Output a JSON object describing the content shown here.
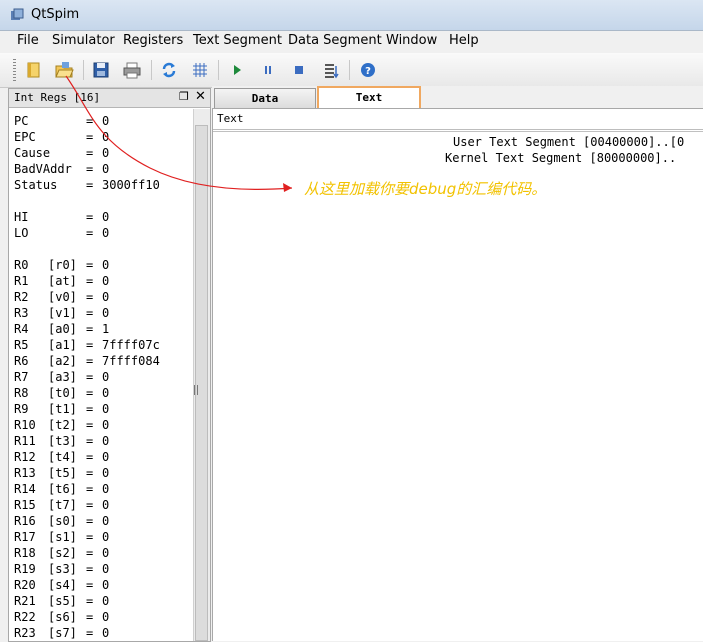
{
  "window": {
    "title": "QtSpim"
  },
  "menu": [
    "File",
    "Simulator",
    "Registers",
    "Text Segment",
    "Data Segment",
    "Window",
    "Help"
  ],
  "toolbar": {
    "icons": [
      "load-file-icon",
      "reload-file-icon",
      "save-log-icon",
      "print-icon",
      "clear-registers-icon",
      "run-grid-icon",
      "run-icon",
      "pause-icon",
      "stop-icon",
      "single-step-icon",
      "help-icon"
    ]
  },
  "registers_panel": {
    "title": "Int Regs [16]",
    "special": [
      {
        "name": "PC",
        "alias": "",
        "value": "0"
      },
      {
        "name": "EPC",
        "alias": "",
        "value": "0"
      },
      {
        "name": "Cause",
        "alias": "",
        "value": "0"
      },
      {
        "name": "BadVAddr",
        "alias": "",
        "value": "0"
      },
      {
        "name": "Status",
        "alias": "",
        "value": "3000ff10"
      },
      {
        "name": "HI",
        "alias": "",
        "value": "0"
      },
      {
        "name": "LO",
        "alias": "",
        "value": "0"
      }
    ],
    "general": [
      {
        "name": "R0",
        "alias": "[r0]",
        "value": "0"
      },
      {
        "name": "R1",
        "alias": "[at]",
        "value": "0"
      },
      {
        "name": "R2",
        "alias": "[v0]",
        "value": "0"
      },
      {
        "name": "R3",
        "alias": "[v1]",
        "value": "0"
      },
      {
        "name": "R4",
        "alias": "[a0]",
        "value": "1"
      },
      {
        "name": "R5",
        "alias": "[a1]",
        "value": "7ffff07c"
      },
      {
        "name": "R6",
        "alias": "[a2]",
        "value": "7ffff084"
      },
      {
        "name": "R7",
        "alias": "[a3]",
        "value": "0"
      },
      {
        "name": "R8",
        "alias": "[t0]",
        "value": "0"
      },
      {
        "name": "R9",
        "alias": "[t1]",
        "value": "0"
      },
      {
        "name": "R10",
        "alias": "[t2]",
        "value": "0"
      },
      {
        "name": "R11",
        "alias": "[t3]",
        "value": "0"
      },
      {
        "name": "R12",
        "alias": "[t4]",
        "value": "0"
      },
      {
        "name": "R13",
        "alias": "[t5]",
        "value": "0"
      },
      {
        "name": "R14",
        "alias": "[t6]",
        "value": "0"
      },
      {
        "name": "R15",
        "alias": "[t7]",
        "value": "0"
      },
      {
        "name": "R16",
        "alias": "[s0]",
        "value": "0"
      },
      {
        "name": "R17",
        "alias": "[s1]",
        "value": "0"
      },
      {
        "name": "R18",
        "alias": "[s2]",
        "value": "0"
      },
      {
        "name": "R19",
        "alias": "[s3]",
        "value": "0"
      },
      {
        "name": "R20",
        "alias": "[s4]",
        "value": "0"
      },
      {
        "name": "R21",
        "alias": "[s5]",
        "value": "0"
      },
      {
        "name": "R22",
        "alias": "[s6]",
        "value": "0"
      },
      {
        "name": "R23",
        "alias": "[s7]",
        "value": "0"
      }
    ]
  },
  "tabs": [
    {
      "label": "Data",
      "active": false
    },
    {
      "label": "Text",
      "active": true
    }
  ],
  "text_panel": {
    "subtab": "Text",
    "lines": [
      "User Text Segment [00400000]..[0",
      "Kernel Text Segment [80000000].."
    ]
  },
  "annotation": {
    "text": "从这里加载你要debug的汇编代码。",
    "color": "#f2c200",
    "arrow_color": "#e02020"
  },
  "colors": {
    "active_tab_border": "#f0a860"
  }
}
